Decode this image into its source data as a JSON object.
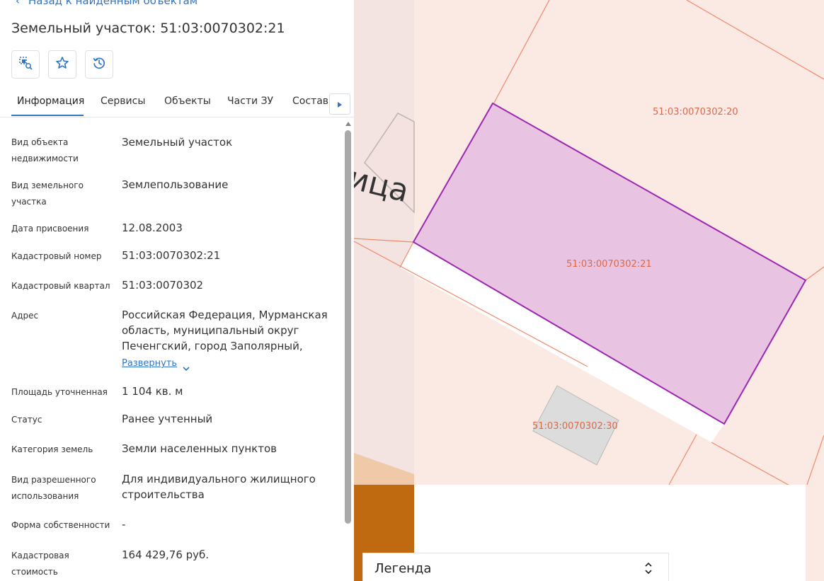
{
  "header": {
    "back_label": "Назад к найденным объектам",
    "title": "Земельный участок: 51:03:0070302:21"
  },
  "toolbar": {
    "select_icon": "select-on-map-icon",
    "favorite_icon": "star-icon",
    "history_icon": "history-icon"
  },
  "tabs": [
    {
      "label": "Информация",
      "active": true
    },
    {
      "label": "Сервисы"
    },
    {
      "label": "Объекты"
    },
    {
      "label": "Части ЗУ"
    },
    {
      "label": "Состав"
    }
  ],
  "info": {
    "rows": [
      {
        "label": "Вид объекта недвижимости",
        "value": "Земельный участок"
      },
      {
        "label": "Вид земельного участка",
        "value": "Землепользование"
      },
      {
        "label": "Дата присвоения",
        "value": "12.08.2003"
      },
      {
        "label": "Кадастровый номер",
        "value": "51:03:0070302:21"
      },
      {
        "label": "Кадастровый квартал",
        "value": "51:03:0070302"
      },
      {
        "label": "Адрес",
        "value": "Российская Федерация, Мурманская область, муниципальный округ Печенгский, город Заполярный,"
      },
      {
        "label": "Площадь уточненная",
        "value": "1 104 кв. м"
      },
      {
        "label": "Статус",
        "value": "Ранее учтенный"
      },
      {
        "label": "Категория земель",
        "value": "Земли населенных пунктов"
      },
      {
        "label": "Вид разрешенного использования",
        "value": "Для индивидуального жилищного строительства"
      },
      {
        "label": "Форма собственности",
        "value": "-"
      },
      {
        "label": "Кадастровая стоимость",
        "value": "164 429,76 руб."
      }
    ],
    "expand_label": "Развернуть"
  },
  "map": {
    "street_fragment": "ица",
    "parcels": [
      {
        "label": "51:03:0070302:20"
      },
      {
        "label": "51:03:0070302:21",
        "selected": true
      },
      {
        "label": "51:03:0070302:30"
      }
    ]
  },
  "legend": {
    "title": "Легенда"
  },
  "colors": {
    "accent": "#2f76c7",
    "selected_fill": "#e8c4e2",
    "selected_stroke": "#9c27b0",
    "parcel_fill": "#fbe9e4",
    "parcel_stroke": "#f08a6b",
    "parcel_label": "#d9694a"
  }
}
